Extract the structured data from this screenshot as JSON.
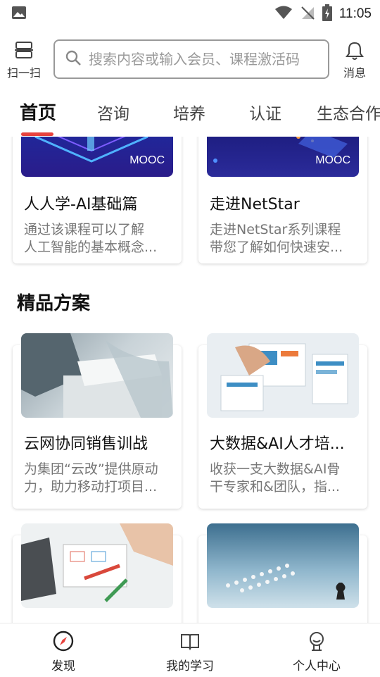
{
  "status_bar": {
    "time": "11:05"
  },
  "header": {
    "scan_label": "扫一扫",
    "search_placeholder": "搜索内容或输入会员、课程激活码",
    "messages_label": "消息"
  },
  "tabs": [
    {
      "label": "首页",
      "active": true
    },
    {
      "label": "咨询"
    },
    {
      "label": "培养"
    },
    {
      "label": "认证"
    },
    {
      "label": "生态合作"
    }
  ],
  "mooc_courses": [
    {
      "badge": "MOOC",
      "title": "人人学-AI基础篇",
      "desc_line1": "通过该课程可以了解",
      "desc_line2": "人工智能的基本概念..."
    },
    {
      "badge": "MOOC",
      "title": "走进NetStar",
      "desc_line1": "走进NetStar系列课程",
      "desc_line2": "带您了解如何快速安..."
    }
  ],
  "section": {
    "title": "精品方案"
  },
  "solutions": [
    {
      "title": "云网协同销售训战",
      "desc_line1": "为集团“云改”提供原动",
      "desc_line2": "力，助力移动打项目..."
    },
    {
      "title": "大数据&AI人才培...",
      "desc_line1": "收获一支大数据&AI骨",
      "desc_line2": "干专家和&团队，指..."
    }
  ],
  "bottom_nav": [
    {
      "label": "发现",
      "icon": "compass-icon",
      "active": true
    },
    {
      "label": "我的学习",
      "icon": "book-icon"
    },
    {
      "label": "个人中心",
      "icon": "person-icon"
    }
  ],
  "colors": {
    "accent": "#e8433e",
    "text_muted": "#777777"
  }
}
